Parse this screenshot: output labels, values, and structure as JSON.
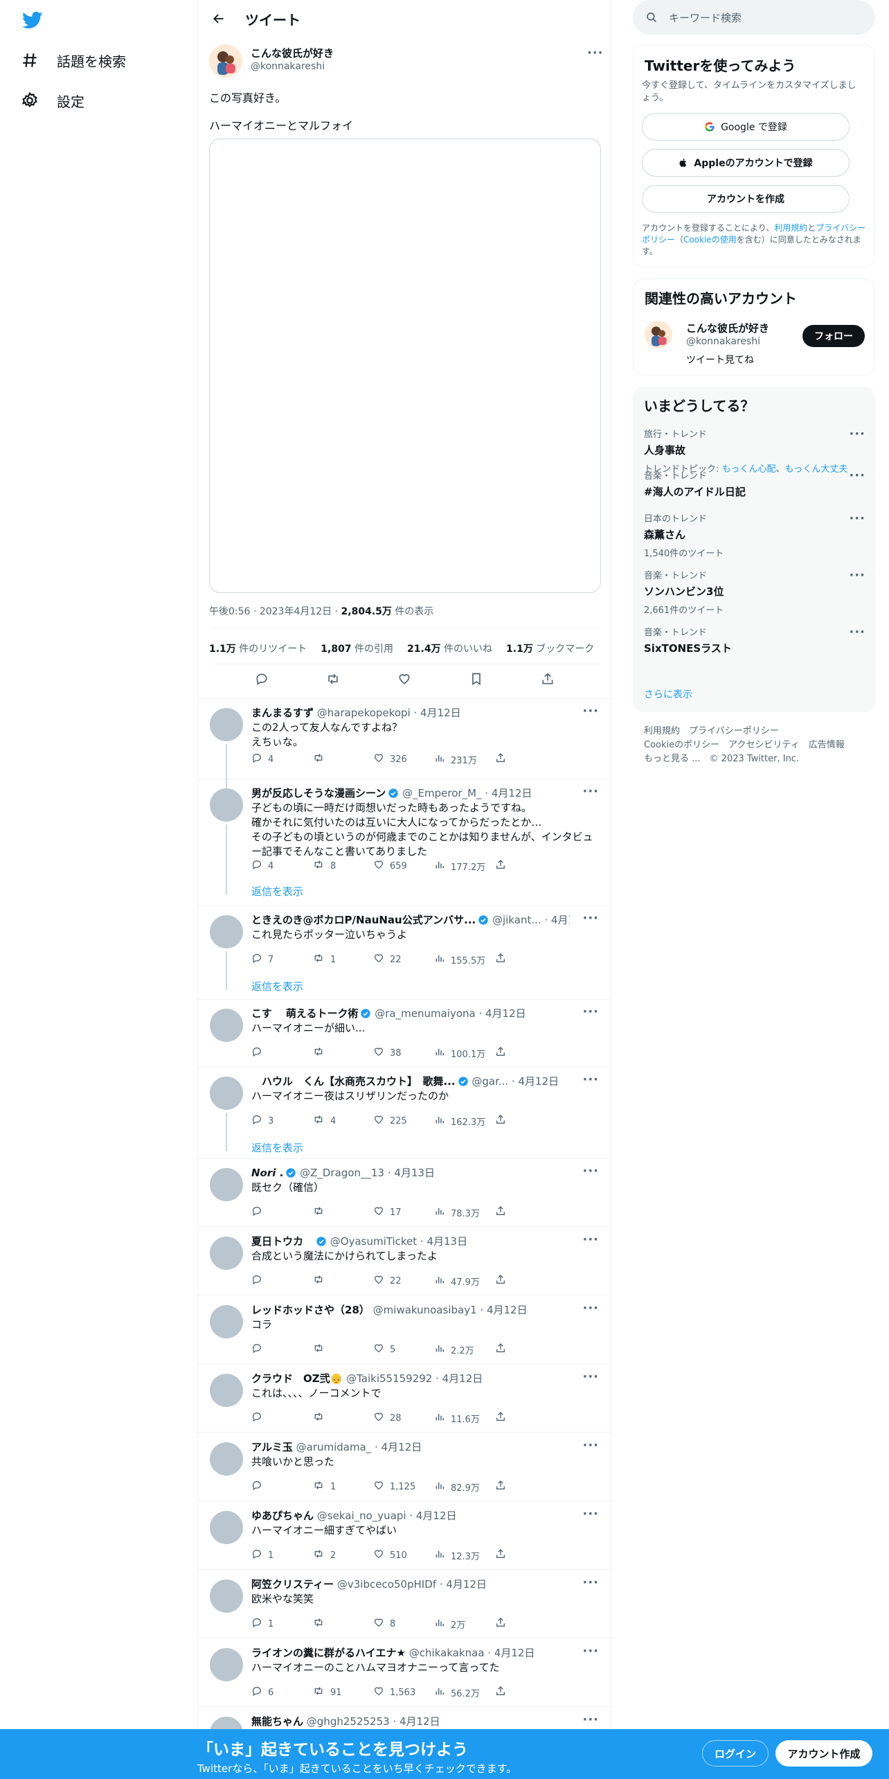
{
  "nav": {
    "explore": "話題を検索",
    "settings": "設定"
  },
  "header": {
    "title": "ツイート"
  },
  "tweet": {
    "name": "こんな彼氏が好き",
    "handle": "@konnakareshi",
    "text1": "この写真好き。",
    "text2": "ハーマイオニーとマルフォイ",
    "time": "午後0:56",
    "date": "2023年4月12日",
    "views": "2,804.5万",
    "views_label": "件の表示",
    "retweets": "1.1万",
    "retweets_label": "件のリツイート",
    "quotes": "1,807",
    "quotes_label": "件の引用",
    "likes": "21.4万",
    "likes_label": "件のいいね",
    "bookmarks": "1.1万",
    "bookmarks_label": "ブックマーク"
  },
  "replies": [
    {
      "name": "まんまるすず",
      "handle": "@harapekopekopi",
      "date": "4月12日",
      "lines": [
        "この2人って友人なんですよね？",
        "えちぃな。"
      ],
      "reply": "4",
      "rt": "",
      "like": "326",
      "view": "231万",
      "verified": false
    },
    {
      "name": "男が反応しそうな漫画シーン",
      "handle": "@_Emperor_M_",
      "date": "4月12日",
      "lines": [
        "子どもの頃に一時だけ両想いだった時もあったようですね。",
        "確かそれに気付いたのは互いに大人になってからだったとか…",
        "その子どもの頃というのが何歳までのことかは知りませんが、インタビュ",
        "ー記事でそんなこと書いてありました"
      ],
      "reply": "4",
      "rt": "8",
      "like": "659",
      "view": "177.2万",
      "verified": true
    },
    {
      "name": "ときえのき@ボカロP/NauNau公式アンバサ...",
      "handle": "@jikant...",
      "date": "4月12日",
      "lines": [
        "これ見たらポッター泣いちゃうよ"
      ],
      "reply": "7",
      "rt": "1",
      "like": "22",
      "view": "155.5万",
      "verified": true
    },
    {
      "name": "こす　 萌えるトーク術",
      "handle": "@ra_menumaiyona",
      "date": "4月12日",
      "lines": [
        "ハーマイオニーが細い..."
      ],
      "reply": "",
      "rt": "",
      "like": "38",
      "view": "100.1万",
      "verified": true
    },
    {
      "name": "　ハウル　くん【水商売スカウト】　歌舞...",
      "handle": "@gar...",
      "date": "4月12日",
      "lines": [
        "ハーマイオニー夜はスリザリンだったのか"
      ],
      "reply": "3",
      "rt": "4",
      "like": "225",
      "view": "162.3万",
      "verified": true
    },
    {
      "name": "𝙉𝙤𝙧𝙞 .",
      "handle": "@Z_Dragon__13",
      "date": "4月13日",
      "lines": [
        "既セク（確信）"
      ],
      "reply": "",
      "rt": "",
      "like": "17",
      "view": "78.3万",
      "verified": true
    },
    {
      "name": "夏日トウカ　",
      "handle": "@OyasumiTicket",
      "date": "4月13日",
      "lines": [
        "合成という魔法にかけられてしまったよ"
      ],
      "reply": "",
      "rt": "",
      "like": "22",
      "view": "47.9万",
      "verified": true
    },
    {
      "name": "レッドホッドさや（28）",
      "handle": "@miwakunoasibay1",
      "date": "4月12日",
      "lines": [
        "コラ"
      ],
      "reply": "",
      "rt": "",
      "like": "5",
      "view": "2.2万",
      "verified": false
    },
    {
      "name": "クラウド　OZ弐👴",
      "handle": "@Taiki55159292",
      "date": "4月12日",
      "lines": [
        "これは、、、、ノーコメントで"
      ],
      "reply": "",
      "rt": "",
      "like": "28",
      "view": "11.6万",
      "verified": false
    },
    {
      "name": "アルミ玉",
      "handle": "@arumidama_",
      "date": "4月12日",
      "lines": [
        "共喰いかと思った"
      ],
      "reply": "",
      "rt": "1",
      "like": "1,125",
      "view": "82.9万",
      "verified": false
    },
    {
      "name": "ゆあぴちゃん",
      "handle": "@sekai_no_yuapi",
      "date": "4月12日",
      "lines": [
        "ハーマイオニー細すぎてやばい"
      ],
      "reply": "1",
      "rt": "2",
      "like": "510",
      "view": "12.3万",
      "verified": false
    },
    {
      "name": "阿笠クリスティー",
      "handle": "@v3ibceco50pHIDf",
      "date": "4月12日",
      "lines": [
        "欧米やな笑笑"
      ],
      "reply": "1",
      "rt": "",
      "like": "8",
      "view": "2万",
      "verified": false
    },
    {
      "name": "ライオンの糞に群がるハイエナ★",
      "handle": "@chikakaknaa",
      "date": "4月12日",
      "lines": [
        "ハーマイオニーのことハムマヨオナニーって言ってた"
      ],
      "reply": "6",
      "rt": "91",
      "like": "1,563",
      "view": "56.2万",
      "verified": false
    },
    {
      "name": "無能ちゃん",
      "handle": "@ghgh2525253",
      "date": "4月12日",
      "lines": [],
      "reply": "",
      "rt": "",
      "like": "",
      "view": "",
      "verified": false
    }
  ],
  "show_replies": "返信を表示",
  "right": {
    "search_placeholder": "キーワード検索",
    "try_title": "Twitterを使ってみよう",
    "try_sub": "今すぐ登録して、タイムラインをカスタマイズしましょう。",
    "google": "Google で登録",
    "apple": "Appleのアカウントで登録",
    "create": "アカウントを作成",
    "terms_pre": "アカウントを登録することにより、",
    "terms_a": "利用規約",
    "terms_mid": "と",
    "terms_b": "プライバシーポリシー",
    "terms_paren_open": "（",
    "terms_c": "Cookieの使用",
    "terms_end": "を含む）に同意したとみなされます。",
    "rel_title": "関連性の高いアカウント",
    "rel_name": "こんな彼氏が好き",
    "rel_handle": "@konnakareshi",
    "rel_bio": "ツイート見てね",
    "follow": "フォロー",
    "trend_title": "いまどうしてる？",
    "show_more": "さらに表示"
  },
  "trends": [
    {
      "cat": "旅行・トレンド",
      "name": "人身事故",
      "extra_pre": "トレンドトピック: ",
      "extra_a": "もっくん心配",
      "extra_sep": "、",
      "extra_b": "もっくん大丈夫"
    },
    {
      "cat": "音楽・トレンド",
      "name": "#海人のアイドル日記",
      "extra": ""
    },
    {
      "cat": "日本のトレンド",
      "name": "森薫さん",
      "extra": "1,540件のツイート"
    },
    {
      "cat": "音楽・トレンド",
      "name": "ソンハンビン3位",
      "extra": "2,661件のツイート"
    },
    {
      "cat": "音楽・トレンド",
      "name": "SixTONESラスト",
      "extra": ""
    }
  ],
  "footer": {
    "l1a": "利用規約",
    "l1b": "プライバシーポリシー",
    "l2a": "Cookieのポリシー",
    "l2b": "アクセシビリティ",
    "l2c": "広告情報",
    "l3a": "もっと見る ...",
    "l3b": "© 2023 Twitter, Inc."
  },
  "banner": {
    "title": "「いま」起きていることを見つけよう",
    "sub": "Twitterなら、「いま」起きていることをいち早くチェックできます。",
    "login": "ログイン",
    "signup": "アカウント作成"
  },
  "colors": {
    "accent": "#1d9bf0",
    "text": "#0f1419",
    "muted": "#536471"
  }
}
